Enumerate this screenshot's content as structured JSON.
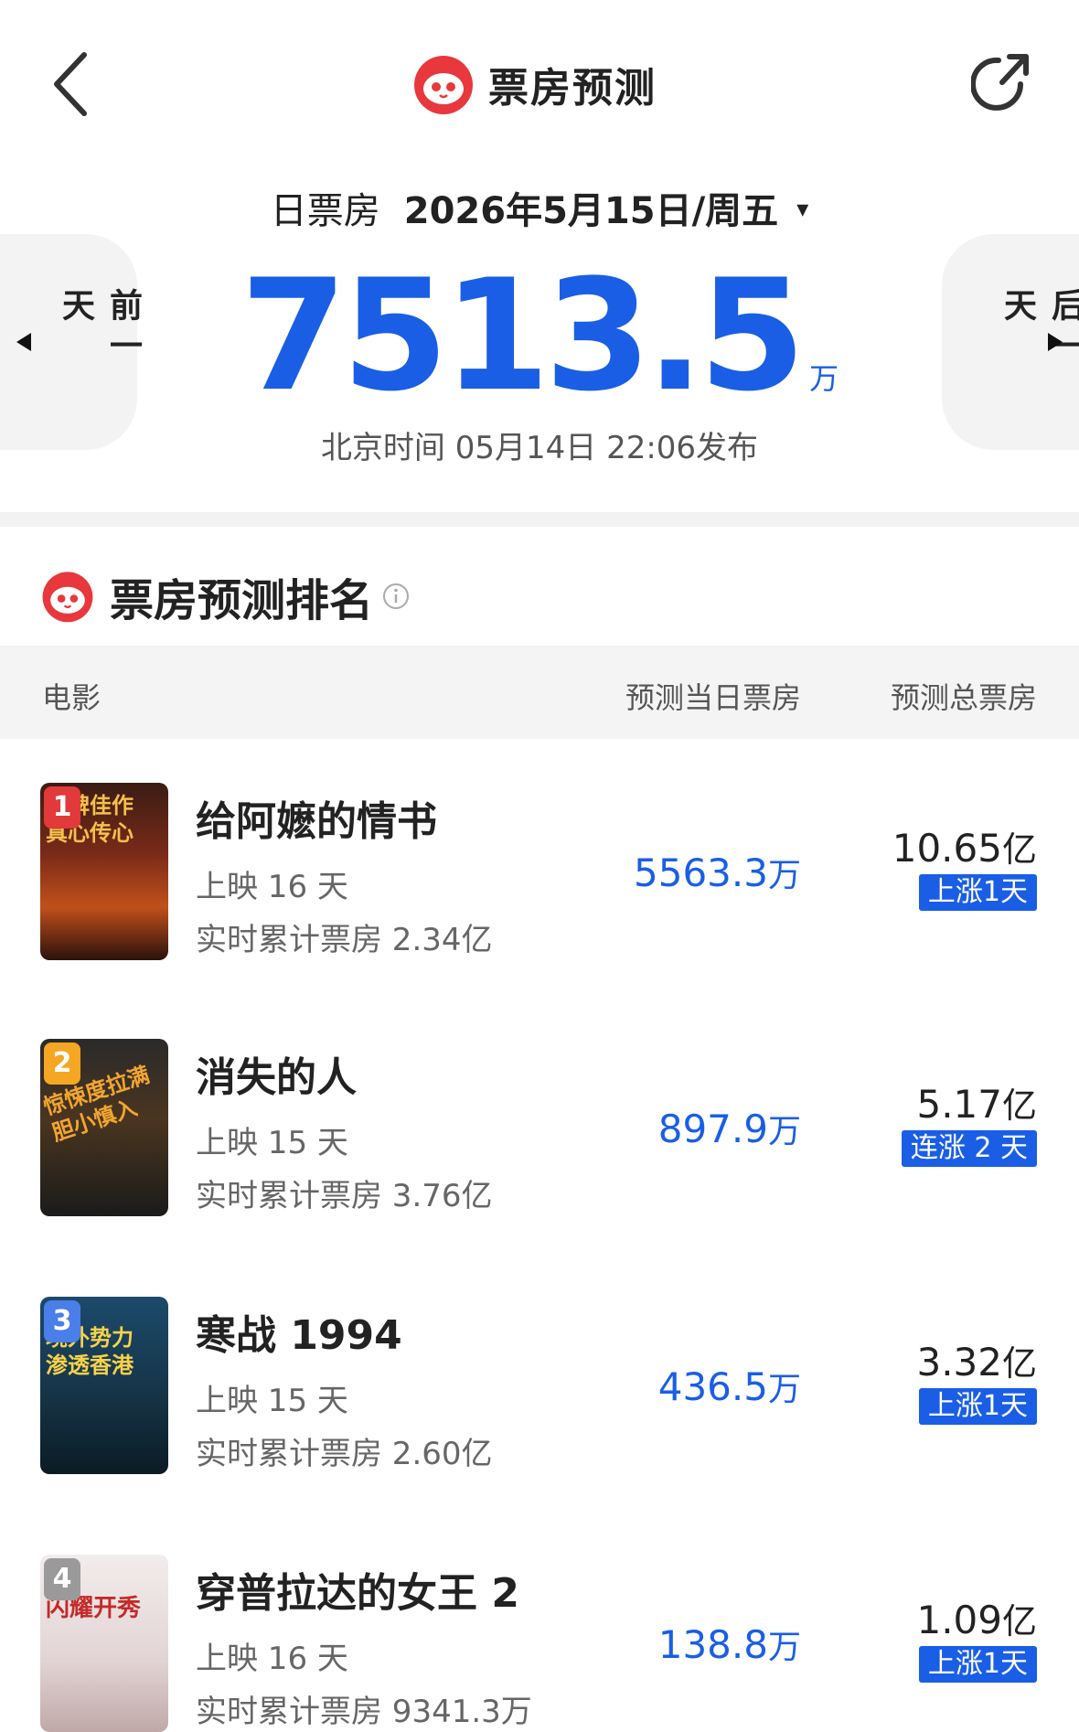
{
  "header": {
    "title": "票房预测",
    "back_icon": "back-arrow-icon",
    "share_icon": "share-icon",
    "logo": "cat-logo-icon",
    "brand_color": "#e8383d"
  },
  "date_row": {
    "label": "日票房",
    "date": "2026年5月15日/周五",
    "caret": "▾"
  },
  "nav": {
    "prev_label": "前一天",
    "next_label": "后一天"
  },
  "headline": {
    "value": "7513.5",
    "unit": "万",
    "color": "#1a5ee6"
  },
  "publish": {
    "text": "北京时间  05月14日  22:06发布"
  },
  "ranking": {
    "title": "票房预测排名",
    "columns": {
      "movie": "电影",
      "day": "预测当日票房",
      "total": "预测总票房"
    },
    "rows": [
      {
        "rank": "1",
        "badge_color": "#e23a3a",
        "poster_text": "口碑佳作 真心传心",
        "title": "给阿嬷的情书",
        "days": "上映 16 天",
        "cumulative": "实时累计票房 2.34亿",
        "day_value": "5563.3",
        "day_unit": "万",
        "total_value": "10.65",
        "total_unit": "亿",
        "trend": "上涨1天"
      },
      {
        "rank": "2",
        "badge_color": "#f5a623",
        "poster_text": "惊悚度拉满 胆小慎入",
        "title": "消失的人",
        "days": "上映 15 天",
        "cumulative": "实时累计票房 3.76亿",
        "day_value": "897.9",
        "day_unit": "万",
        "total_value": "5.17",
        "total_unit": "亿",
        "trend": "连涨 2 天"
      },
      {
        "rank": "3",
        "badge_color": "#4a7ee8",
        "poster_text": "境外势力 渗透香港",
        "title": "寒战 1994",
        "days": "上映 15 天",
        "cumulative": "实时累计票房 2.60亿",
        "day_value": "436.5",
        "day_unit": "万",
        "total_value": "3.32",
        "total_unit": "亿",
        "trend": "上涨1天"
      },
      {
        "rank": "4",
        "badge_color": "#9a9a9a",
        "poster_text": "闪耀开秀",
        "title": "穿普拉达的女王 2",
        "days": "上映 16 天",
        "cumulative": "实时累计票房 9341.3万",
        "day_value": "138.8",
        "day_unit": "万",
        "total_value": "1.09",
        "total_unit": "亿",
        "trend": "上涨1天"
      }
    ]
  }
}
